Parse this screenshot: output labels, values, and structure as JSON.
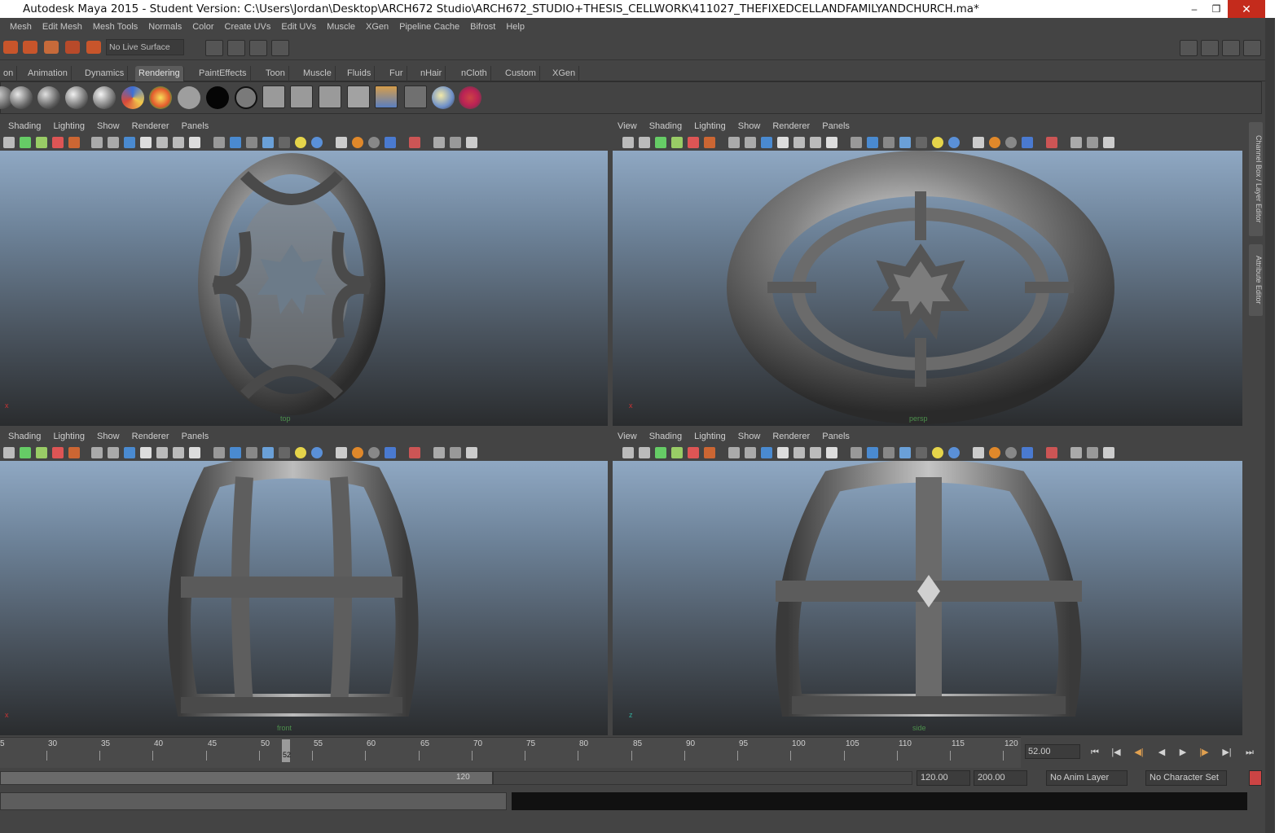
{
  "window": {
    "title": "Autodesk Maya 2015 - Student Version: C:\\Users\\Jordan\\Desktop\\ARCH672 Studio\\ARCH672_STUDIO+THESIS_CELLWORK\\411027_THEFIXEDCELLANDFAMILYANDCHURCH.ma*",
    "minimize": "–",
    "maximize": "❒",
    "close": "✕"
  },
  "menubar": [
    "Mesh",
    "Edit Mesh",
    "Mesh Tools",
    "Normals",
    "Color",
    "Create UVs",
    "Edit UVs",
    "Muscle",
    "XGen",
    "Pipeline Cache",
    "Bifrost",
    "Help"
  ],
  "status_line": {
    "live_surface": "No Live Surface"
  },
  "shelf_tabs": [
    "on",
    "Animation",
    "Dynamics",
    "Rendering",
    "PaintEffects",
    "Toon",
    "Muscle",
    "Fluids",
    "Fur",
    "nHair",
    "nCloth",
    "Custom",
    "XGen"
  ],
  "active_shelf_tab": "Rendering",
  "panels": {
    "top_left": {
      "menu": [
        "Shading",
        "Lighting",
        "Show",
        "Renderer",
        "Panels"
      ],
      "camera": "top",
      "axis": "x"
    },
    "top_right": {
      "menu": [
        "View",
        "Shading",
        "Lighting",
        "Show",
        "Renderer",
        "Panels"
      ],
      "camera": "persp",
      "axis": "x"
    },
    "bottom_left": {
      "menu": [
        "Shading",
        "Lighting",
        "Show",
        "Renderer",
        "Panels"
      ],
      "camera": "front",
      "axis": "x"
    },
    "bottom_right": {
      "menu": [
        "View",
        "Shading",
        "Lighting",
        "Show",
        "Renderer",
        "Panels"
      ],
      "camera": "side",
      "axis": "z"
    }
  },
  "timeline": {
    "ticks": [
      "5",
      "30",
      "35",
      "40",
      "45",
      "50",
      "55",
      "60",
      "65",
      "70",
      "75",
      "80",
      "85",
      "90",
      "95",
      "100",
      "105",
      "110",
      "115",
      "120"
    ],
    "current_frame": "52",
    "current_time_field": "52.00"
  },
  "playback": {
    "go_start": "⏮",
    "step_back_key": "|◀",
    "step_back_frame": "◀|",
    "play_back": "◀",
    "play_forward": "▶",
    "step_forward_frame": "|▶",
    "step_forward_key": "▶|",
    "go_end": "⏭"
  },
  "range": {
    "end_label": "120",
    "end_time": "120.00",
    "max_time": "200.00",
    "anim_layer": "No Anim Layer",
    "character_set": "No Character Set"
  },
  "side_tabs": {
    "channel_box": "Channel Box / Layer Editor",
    "attribute_editor": "Attribute Editor"
  },
  "colors": {
    "title_bg": "#ffffff",
    "close_bg": "#c42b1c",
    "ui_bg": "#444444",
    "viewport_top": "#8fa8c3",
    "viewport_bottom": "#2a2c2e",
    "model": "#8a8a8a"
  }
}
